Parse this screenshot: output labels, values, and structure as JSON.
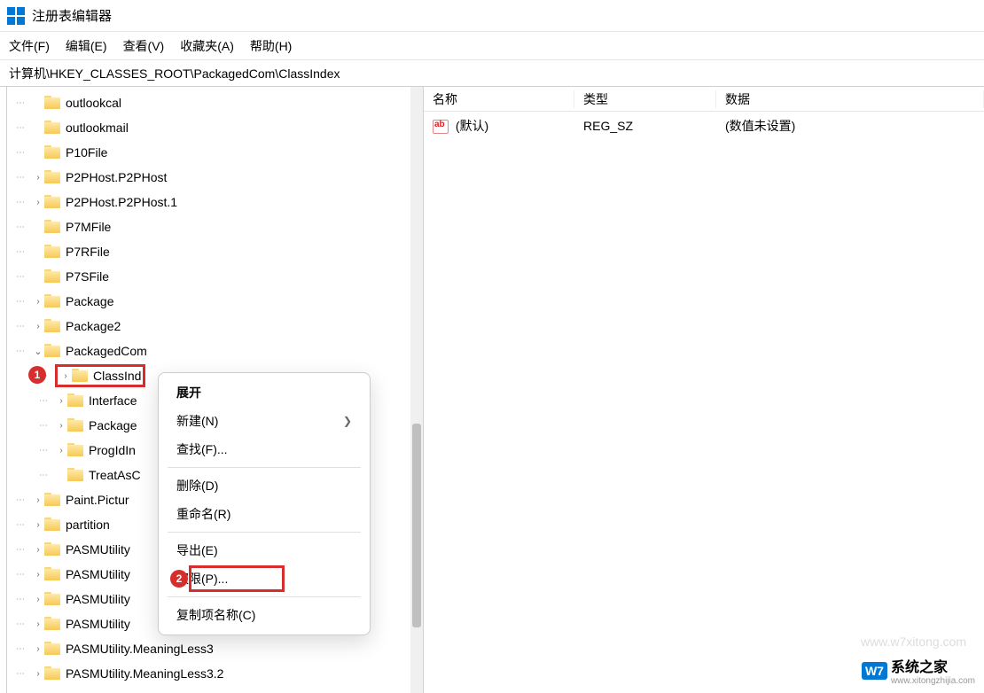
{
  "window": {
    "title": "注册表编辑器"
  },
  "menu": {
    "file": "文件(F)",
    "edit": "编辑(E)",
    "view": "查看(V)",
    "favorites": "收藏夹(A)",
    "help": "帮助(H)"
  },
  "address": "计算机\\HKEY_CLASSES_ROOT\\PackagedCom\\ClassIndex",
  "tree": [
    {
      "label": "outlookcal",
      "depth": 2,
      "exp": ""
    },
    {
      "label": "outlookmail",
      "depth": 2,
      "exp": ""
    },
    {
      "label": "P10File",
      "depth": 2,
      "exp": ""
    },
    {
      "label": "P2PHost.P2PHost",
      "depth": 2,
      "exp": ">"
    },
    {
      "label": "P2PHost.P2PHost.1",
      "depth": 2,
      "exp": ">"
    },
    {
      "label": "P7MFile",
      "depth": 2,
      "exp": ""
    },
    {
      "label": "P7RFile",
      "depth": 2,
      "exp": ""
    },
    {
      "label": "P7SFile",
      "depth": 2,
      "exp": ""
    },
    {
      "label": "Package",
      "depth": 2,
      "exp": ">"
    },
    {
      "label": "Package2",
      "depth": 2,
      "exp": ">"
    },
    {
      "label": "PackagedCom",
      "depth": 2,
      "exp": "v"
    },
    {
      "label": "ClassInd",
      "depth": 3,
      "exp": ">",
      "selected": true
    },
    {
      "label": "Interface",
      "depth": 3,
      "exp": ">"
    },
    {
      "label": "Package",
      "depth": 3,
      "exp": ">"
    },
    {
      "label": "ProgIdIn",
      "depth": 3,
      "exp": ">"
    },
    {
      "label": "TreatAsC",
      "depth": 3,
      "exp": ""
    },
    {
      "label": "Paint.Pictur",
      "depth": 2,
      "exp": ">"
    },
    {
      "label": "partition",
      "depth": 2,
      "exp": ">"
    },
    {
      "label": "PASMUtility",
      "depth": 2,
      "exp": ">"
    },
    {
      "label": "PASMUtility",
      "depth": 2,
      "exp": ">"
    },
    {
      "label": "PASMUtility",
      "depth": 2,
      "exp": ">"
    },
    {
      "label": "PASMUtility",
      "depth": 2,
      "exp": ">"
    },
    {
      "label": "PASMUtility.MeaningLess3",
      "depth": 2,
      "exp": ">"
    },
    {
      "label": "PASMUtility.MeaningLess3.2",
      "depth": 2,
      "exp": ">"
    }
  ],
  "list": {
    "headers": {
      "name": "名称",
      "type": "类型",
      "data": "数据"
    },
    "rows": [
      {
        "name": "(默认)",
        "type": "REG_SZ",
        "data": "(数值未设置)"
      }
    ]
  },
  "context_menu": {
    "expand": "展开",
    "new": "新建(N)",
    "find": "查找(F)...",
    "delete": "删除(D)",
    "rename": "重命名(R)",
    "export": "导出(E)",
    "permissions": "权限(P)...",
    "copy_key_name": "复制项名称(C)"
  },
  "markers": {
    "m1": "1",
    "m2": "2"
  },
  "watermark": {
    "url": "www.w7xitong.com",
    "brand_prefix": "W7",
    "brand_text": "系统之家",
    "brand_url": "www.xitongzhijia.com"
  }
}
